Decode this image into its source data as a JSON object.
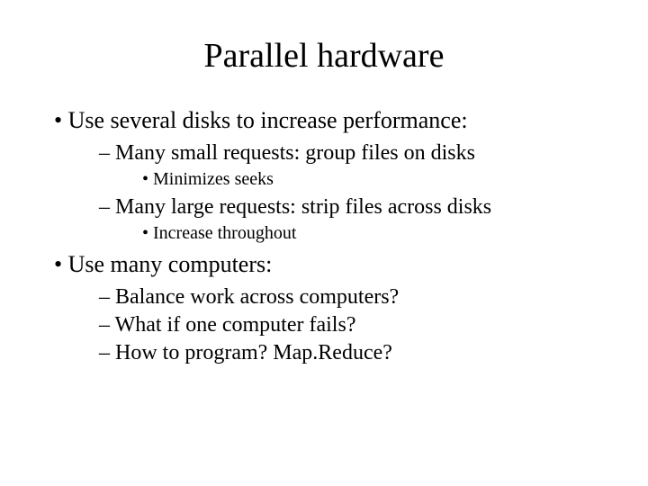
{
  "title": "Parallel hardware",
  "points": {
    "p1": "Use several disks to increase performance:",
    "p1a": "Many small requests:  group files on disks",
    "p1a_i": "Minimizes seeks",
    "p1b": "Many large requests: strip files across disks",
    "p1b_i": "Increase throughout",
    "p2": "Use many computers:",
    "p2a": "Balance work across computers?",
    "p2b": "What if one computer fails?",
    "p2c": "How to program?   Map.Reduce?"
  }
}
